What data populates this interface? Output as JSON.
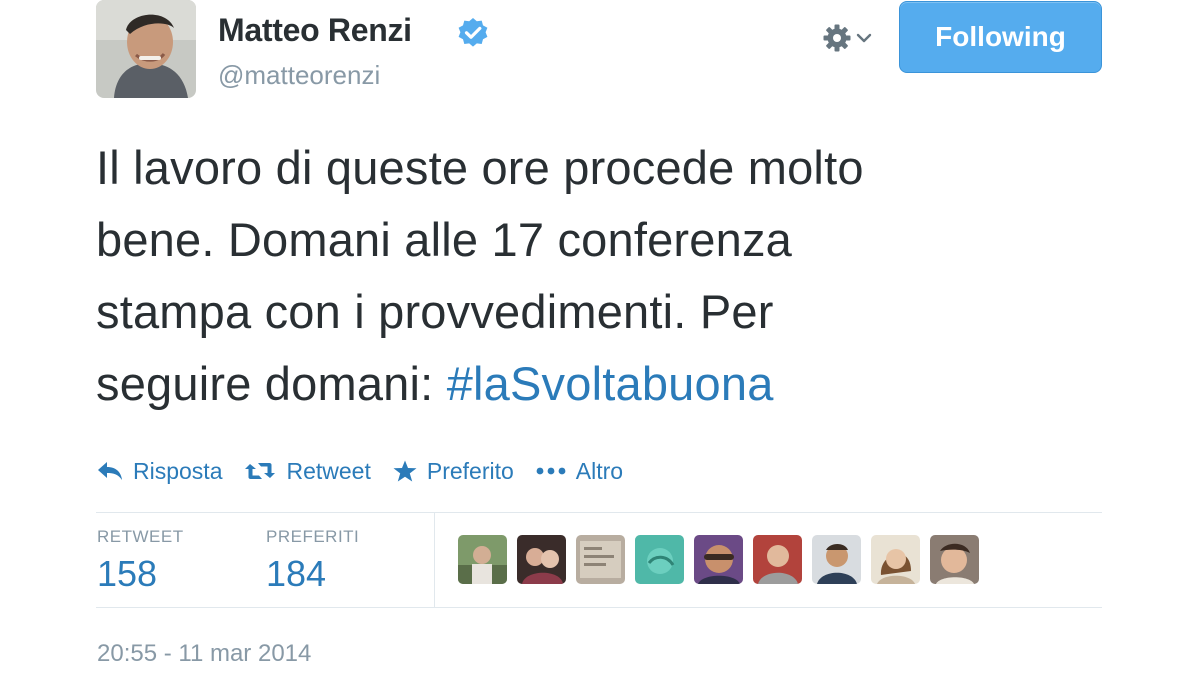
{
  "user": {
    "name": "Matteo Renzi",
    "screen_name": "@matteorenzi",
    "verified": true,
    "verified_icon": "verified-badge-icon"
  },
  "header": {
    "follow_button_label": "Following",
    "settings_icon": "gear-icon"
  },
  "tweet": {
    "text_lines": [
      "Il lavoro di queste ore procede molto",
      "bene. Domani alle 17 conferenza",
      "stampa con i provvedimenti. Per",
      "seguire domani: "
    ],
    "hashtag": "#laSvoltabuona"
  },
  "actions": [
    {
      "label": "Risposta",
      "icon": "reply-icon"
    },
    {
      "label": "Retweet",
      "icon": "retweet-icon"
    },
    {
      "label": "Preferito",
      "icon": "star-icon"
    },
    {
      "label": "Altro",
      "icon": "more-icon"
    }
  ],
  "stats": {
    "retweet_label": "RETWEET",
    "retweet_count": "158",
    "favorites_label": "PREFERITI",
    "favorites_count": "184"
  },
  "timestamp": "20:55 - 11 mar 2014",
  "colors": {
    "link_blue": "#2b7bb9",
    "follow_button": "#55acee",
    "muted_gray": "#8899a6",
    "text": "#292f33"
  }
}
